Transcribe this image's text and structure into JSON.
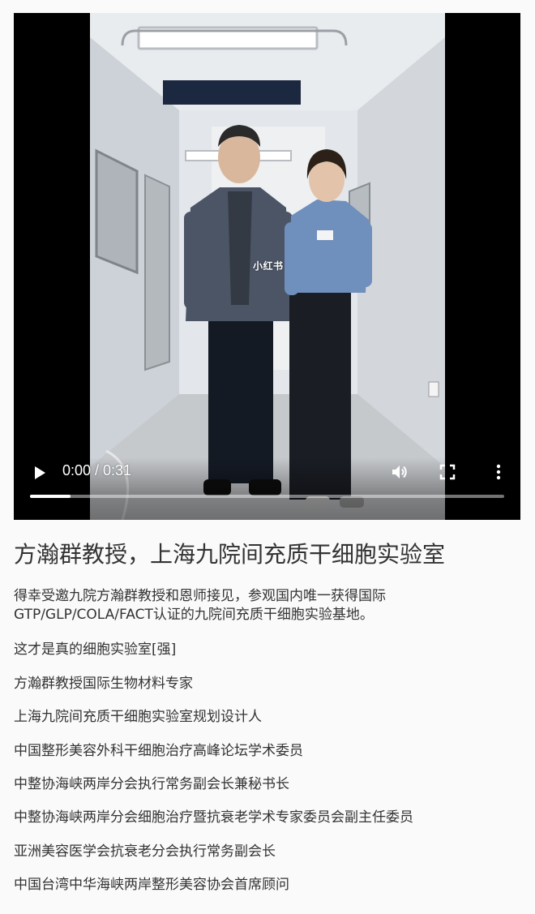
{
  "video": {
    "watermark": "小红书",
    "current_time": "0:00",
    "duration": "0:31",
    "time_display": "0:00 / 0:31",
    "progress_fraction": 0.085,
    "controls": {
      "play_icon": "play-icon",
      "volume_icon": "volume-icon",
      "fullscreen_icon": "fullscreen-icon",
      "more_icon": "more-vertical-icon"
    }
  },
  "article": {
    "title": "方瀚群教授，上海九院间充质干细胞实验室",
    "intro_line1": "得幸受邀九院方瀚群教授和恩师接见，参观国内唯一获得国际",
    "intro_line2": "GTP/GLP/COLA/FACT认证的九院间充质干细胞实验基地。",
    "lines": [
      "这才是真的细胞实验室[强]",
      "方瀚群教授国际生物材料专家",
      "上海九院间充质干细胞实验室规划设计人",
      "中国整形美容外科干细胞治疗高峰论坛学术委员",
      "中整协海峡两岸分会执行常务副会长兼秘书长",
      "中整协海峡两岸分会细胞治疗暨抗衰老学术专家委员会副主任委员",
      "亚洲美容医学会抗衰老分会执行常务副会长",
      "中国台湾中华海峡两岸整形美容协会首席顾问"
    ]
  },
  "colors": {
    "page_background": "#fafafa",
    "text": "#333333",
    "player_background": "#000000",
    "control_foreground": "#ffffff"
  }
}
